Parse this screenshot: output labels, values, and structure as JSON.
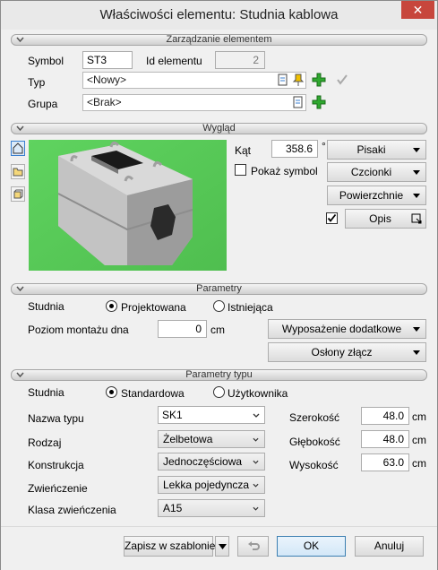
{
  "window": {
    "title": "Właściwości elementu: Studnia kablowa",
    "close": "✕"
  },
  "sections": {
    "management": "Zarządzanie elementem",
    "appearance": "Wygląd",
    "parameters": "Parametry",
    "type_parameters": "Parametry typu"
  },
  "management": {
    "symbol_label": "Symbol",
    "symbol_value": "ST3",
    "id_label": "Id elementu",
    "id_value": "2",
    "type_label": "Typ",
    "type_value": "<Nowy>",
    "group_label": "Grupa",
    "group_value": "<Brak>"
  },
  "appearance": {
    "angle_label": "Kąt",
    "angle_value": "358.6",
    "angle_unit": "°",
    "show_symbol_label": "Pokaż symbol",
    "show_symbol_checked": false,
    "description_checked": true,
    "pens_label": "Pisaki",
    "fonts_label": "Czcionki",
    "surfaces_label": "Powierzchnie",
    "description_label": "Opis"
  },
  "parameters": {
    "well_label": "Studnia",
    "radio_designed": "Projektowana",
    "radio_existing": "Istniejąca",
    "selected": "Projektowana",
    "bottom_level_label": "Poziom montażu dna",
    "bottom_level_value": "0",
    "bottom_level_unit": "cm",
    "extra_equipment_label": "Wyposażenie dodatkowe",
    "joint_covers_label": "Osłony złącz"
  },
  "type_parameters": {
    "well_label": "Studnia",
    "radio_standard": "Standardowa",
    "radio_user": "Użytkownika",
    "selected": "Standardowa",
    "type_name_label": "Nazwa typu",
    "type_name_value": "SK1",
    "kind_label": "Rodzaj",
    "kind_value": "Żelbetowa",
    "construction_label": "Konstrukcja",
    "construction_value": "Jednoczęściowa",
    "finish_label": "Zwieńczenie",
    "finish_value": "Lekka pojedyncza",
    "finish_class_label": "Klasa zwieńczenia",
    "finish_class_value": "A15",
    "width_label": "Szerokość",
    "width_value": "48.0",
    "depth_label": "Głębokość",
    "depth_value": "48.0",
    "height_label": "Wysokość",
    "height_value": "63.0",
    "unit": "cm"
  },
  "footer": {
    "save_template_label": "Zapisz w szablonie",
    "ok_label": "OK",
    "cancel_label": "Anuluj"
  },
  "colors": {
    "preview_bg": "#5fd35f",
    "accent_green": "#2fa82f",
    "close_red": "#c7463c"
  }
}
